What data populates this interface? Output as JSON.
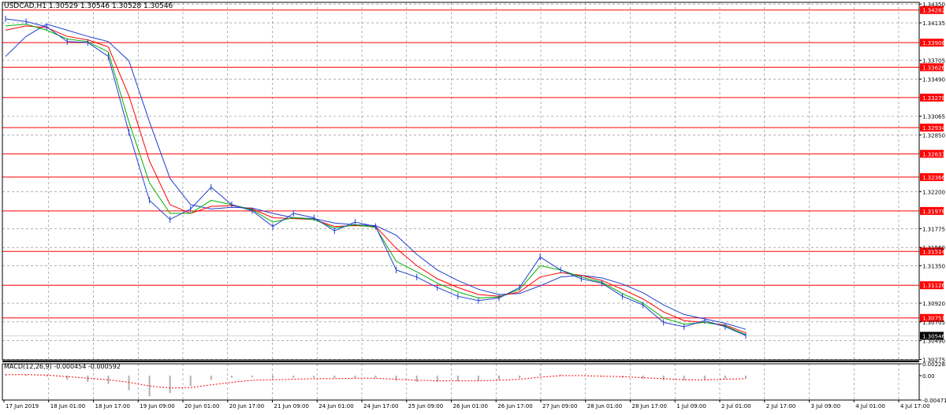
{
  "header": {
    "title": "USDCAD,H1  1.30529 1.30546 1.30528 1.30546",
    "macd_label": "MACD(12,26,9) -0.000454 -0.000592"
  },
  "colors": {
    "price": "#1f3fd0",
    "ma_fast": "#00b000",
    "ma_mid": "#ff0000",
    "ma_slow": "#1f3fd0",
    "level_line": "#ff0000",
    "level_label_bg": "#ff0000",
    "current_price_bg": "#000000",
    "grid": "#808080",
    "histogram": "#b0b0b0",
    "signal": "#ff0000"
  },
  "chart_data": [
    {
      "type": "line",
      "title": "USDCAD,H1",
      "x": [
        "17 Jun 2019",
        "18 Jun 01:00",
        "18 Jun 17:00",
        "19 Jun 09:00",
        "20 Jun 01:00",
        "20 Jun 17:00",
        "21 Jun 09:00",
        "24 Jun 01:00",
        "24 Jun 17:00",
        "25 Jun 09:00",
        "26 Jun 01:00",
        "26 Jun 17:00",
        "27 Jun 09:00",
        "28 Jun 01:00",
        "28 Jun 17:00",
        "1 Jul 09:00",
        "2 Jul 01:00",
        "2 Jul 17:00",
        "3 Jul 09:00",
        "4 Jul 01:00",
        "4 Jul 17:00"
      ],
      "y_ticks": [
        "1.34350",
        "1.34135",
        "1.33705",
        "1.33490",
        "1.33065",
        "1.32850",
        "1.32200",
        "1.31775",
        "1.31560",
        "1.31350",
        "1.30920",
        "1.30705",
        "1.30490",
        "1.30275"
      ],
      "ylim": [
        1.3027,
        1.3437
      ],
      "series": [
        {
          "role": "price",
          "values": [
            1.3418,
            1.3415,
            1.3409,
            1.3392,
            1.3391,
            1.3375,
            1.3288,
            1.321,
            1.3188,
            1.32,
            1.3225,
            1.3205,
            1.3198,
            1.318,
            1.3195,
            1.319,
            1.3175,
            1.3185,
            1.318,
            1.313,
            1.3122,
            1.311,
            1.31,
            1.3095,
            1.3098,
            1.311,
            1.3145,
            1.313,
            1.312,
            1.3115,
            1.31,
            1.309,
            1.307,
            1.3065,
            1.3072,
            1.3065,
            1.3055
          ]
        },
        {
          "role": "ma_fast",
          "values": [
            1.341,
            1.3412,
            1.3405,
            1.3395,
            1.3392,
            1.338,
            1.33,
            1.323,
            1.3195,
            1.3195,
            1.321,
            1.3205,
            1.3199,
            1.3185,
            1.319,
            1.3188,
            1.3178,
            1.3182,
            1.3179,
            1.314,
            1.3128,
            1.3115,
            1.3105,
            1.3098,
            1.3099,
            1.3108,
            1.3135,
            1.313,
            1.3122,
            1.3116,
            1.3103,
            1.3092,
            1.3075,
            1.3068,
            1.307,
            1.3066,
            1.3056
          ]
        },
        {
          "role": "ma_mid",
          "values": [
            1.3405,
            1.341,
            1.3408,
            1.3398,
            1.3394,
            1.3386,
            1.333,
            1.3255,
            1.3205,
            1.3195,
            1.3203,
            1.3204,
            1.32,
            1.319,
            1.3189,
            1.3188,
            1.318,
            1.3181,
            1.318,
            1.3155,
            1.3135,
            1.312,
            1.311,
            1.3102,
            1.31,
            1.3105,
            1.3122,
            1.3127,
            1.3124,
            1.3118,
            1.3108,
            1.3097,
            1.3082,
            1.3072,
            1.307,
            1.3067,
            1.3058
          ]
        },
        {
          "role": "ma_slow",
          "values": [
            1.3375,
            1.3398,
            1.3412,
            1.3405,
            1.3398,
            1.3392,
            1.337,
            1.33,
            1.3235,
            1.3205,
            1.32,
            1.3202,
            1.3201,
            1.3195,
            1.319,
            1.3189,
            1.3184,
            1.3182,
            1.3181,
            1.317,
            1.3148,
            1.313,
            1.3118,
            1.3108,
            1.3102,
            1.3103,
            1.3112,
            1.3122,
            1.3124,
            1.3121,
            1.3114,
            1.3104,
            1.309,
            1.3079,
            1.3074,
            1.3069,
            1.3062
          ]
        }
      ],
      "levels": [
        "1.34282",
        "1.33908",
        "1.33626",
        "1.33278",
        "1.32934",
        "1.32633",
        "1.32366",
        "1.31978",
        "1.31514",
        "1.31126",
        "1.30751"
      ],
      "current_price": "1.30546"
    },
    {
      "type": "bar",
      "title": "MACD(12,26,9)",
      "y_ticks": [
        "0.002282",
        "0.00",
        "-0.004718"
      ],
      "ylim": [
        -0.004718,
        0.002282
      ],
      "histogram": [
        0.0002,
        0.0002,
        -0.0002,
        -0.0008,
        -0.0012,
        -0.0016,
        -0.0028,
        -0.004,
        -0.0034,
        -0.002,
        -0.0008,
        -0.0004,
        -0.0003,
        -0.0005,
        -0.0004,
        -0.0004,
        -0.0005,
        -0.0004,
        -0.0004,
        -0.001,
        -0.0012,
        -0.0012,
        -0.0011,
        -0.001,
        -0.0008,
        -0.0005,
        0.0004,
        0.0002,
        0.0,
        -0.0002,
        -0.0004,
        -0.0006,
        -0.0009,
        -0.0009,
        -0.0007,
        -0.0006,
        -0.0005
      ],
      "signal": [
        0.0002,
        0.0002,
        0.0001,
        -0.0002,
        -0.0005,
        -0.0008,
        -0.0013,
        -0.002,
        -0.0024,
        -0.0023,
        -0.0018,
        -0.0013,
        -0.0009,
        -0.0008,
        -0.0007,
        -0.0006,
        -0.0006,
        -0.0005,
        -0.0005,
        -0.0007,
        -0.0009,
        -0.001,
        -0.001,
        -0.001,
        -0.0009,
        -0.0007,
        -0.0003,
        0.0,
        0.0,
        -0.0001,
        -0.0002,
        -0.0004,
        -0.0006,
        -0.0008,
        -0.0008,
        -0.0007,
        -0.0006
      ]
    }
  ]
}
